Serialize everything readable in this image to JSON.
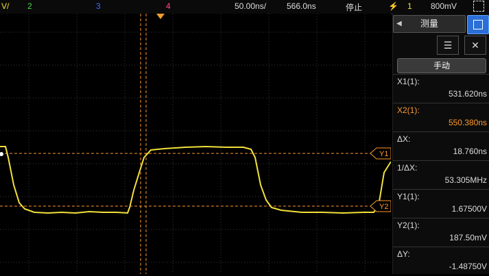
{
  "topbar": {
    "ch_prefix": "V/",
    "ch2": "2",
    "ch3": "3",
    "ch4": "4",
    "timebase": "50.00ns/",
    "delay": "566.0ns",
    "run_state": "停止",
    "trigger_channel": "1",
    "trigger_level": "800mV"
  },
  "colors": {
    "ch1": "#f3e23a",
    "ch2": "#4cd94c",
    "ch3": "#3f6cff",
    "ch4": "#ff4a8a",
    "cursor": "#ff9a2e",
    "accent": "#2a6fd6"
  },
  "waveform": {
    "cursor_y1_label": "Y1",
    "cursor_y2_label": "Y2"
  },
  "panel": {
    "tab_label": "测量",
    "icons": [
      "list-icon",
      "close-icon"
    ],
    "manual_button": "手动",
    "rows": [
      {
        "label": "X1(1):",
        "value": "531.620ns"
      },
      {
        "label": "X2(1):",
        "value": "550.380ns"
      },
      {
        "label": "ΔX:",
        "value": "18.760ns"
      },
      {
        "label": "1/ΔX:",
        "value": "53.305MHz"
      },
      {
        "label": "Y1(1):",
        "value": "1.67500V"
      },
      {
        "label": "Y2(1):",
        "value": "187.50mV"
      },
      {
        "label": "ΔY:",
        "value": "-1.48750V"
      }
    ]
  }
}
